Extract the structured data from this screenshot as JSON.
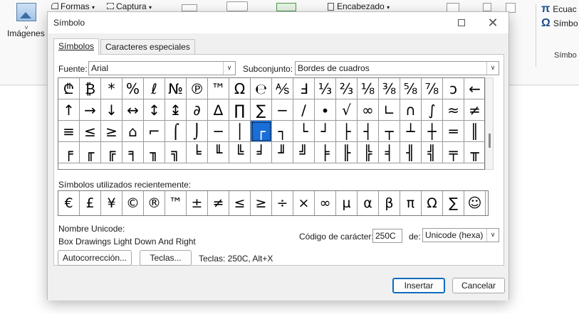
{
  "ribbon": {
    "images_label": "Imágenes",
    "shapes_label": "Formas",
    "capture_label": "Captura",
    "header_label": "Encabezado",
    "equation_label": "Ecuac",
    "symbol_label": "Símbo",
    "group_label": "Símbo",
    "equation_glyph": "π",
    "symbol_glyph": "Ω",
    "dropdown_chevron": "˅"
  },
  "dialog": {
    "title": "Símbolo",
    "tabs": [
      {
        "label": "Símbolos"
      },
      {
        "label": "Caracteres especiales"
      }
    ],
    "font_label": "Fuente:",
    "font_value": "Arial",
    "subset_label": "Subconjunto:",
    "subset_value": "Bordes de cuadros",
    "grid_rows": [
      [
        "₾",
        "₿",
        "*",
        "%",
        "ℓ",
        "№",
        "℗",
        "™",
        "Ω",
        "℮",
        "⅍",
        "Ⅎ",
        "⅓",
        "⅔",
        "⅛",
        "⅜",
        "⅝",
        "⅞",
        "ↄ",
        "←"
      ],
      [
        "↑",
        "→",
        "↓",
        "↔",
        "↕",
        "↨",
        "∂",
        "∆",
        "∏",
        "∑",
        "−",
        "∕",
        "∙",
        "√",
        "∞",
        "∟",
        "∩",
        "∫",
        "≈",
        "≠"
      ],
      [
        "≡",
        "≤",
        "≥",
        "⌂",
        "⌐",
        "⌠",
        "⌡",
        "─",
        "│",
        "┌",
        "┐",
        "└",
        "┘",
        "├",
        "┤",
        "┬",
        "┴",
        "┼",
        "═",
        "║"
      ],
      [
        "╒",
        "╓",
        "╔",
        "╕",
        "╖",
        "╗",
        "╘",
        "╙",
        "╚",
        "╛",
        "╜",
        "╝",
        "╞",
        "╟",
        "╠",
        "╡",
        "╢",
        "╣",
        "╤",
        "╥"
      ]
    ],
    "selected_symbol": "┌",
    "recent_label": "Símbolos utilizados recientemente:",
    "recent_symbols": [
      "€",
      "£",
      "¥",
      "©",
      "®",
      "™",
      "±",
      "≠",
      "≤",
      "≥",
      "÷",
      "×",
      "∞",
      "µ",
      "α",
      "β",
      "π",
      "Ω",
      "∑",
      "☺"
    ],
    "unicode_name_label": "Nombre Unicode:",
    "unicode_name_value": "Box Drawings Light Down And Right",
    "char_code_label": "Código de carácter:",
    "char_code_value": "250C",
    "from_label": "de:",
    "from_value": "Unicode (hexa)",
    "autocorrect_button": "Autocorrección...",
    "keys_button": "Teclas...",
    "keys_text": "Teclas: 250C, Alt+X",
    "insert_button": "Insertar",
    "cancel_button": "Cancelar",
    "close_glyph": "✕",
    "dropdown_arrow": "∨"
  },
  "colors": {
    "selection": "#1a6ed8",
    "primary_border": "#0f6cbd"
  }
}
